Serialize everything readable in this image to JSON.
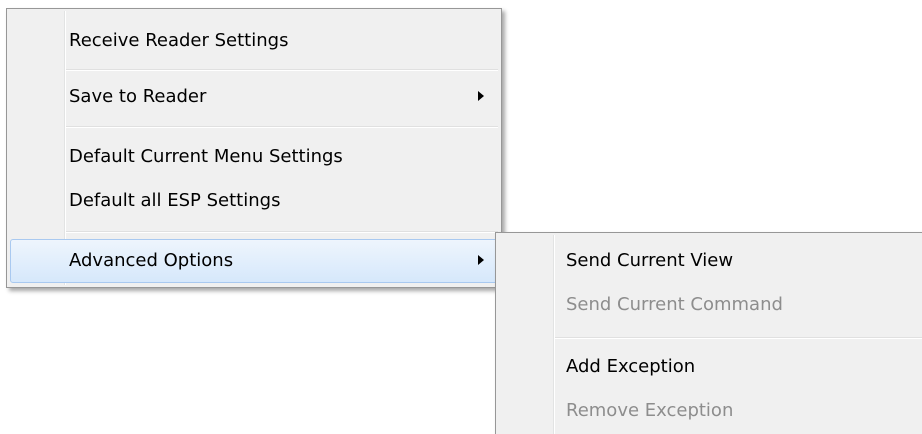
{
  "main_menu": {
    "items": [
      {
        "label": "Receive Reader Settings"
      },
      {
        "label": "Save to Reader"
      },
      {
        "label": "Default Current Menu Settings"
      },
      {
        "label": "Default all ESP Settings"
      },
      {
        "label": "Advanced Options"
      }
    ]
  },
  "submenu": {
    "items": [
      {
        "label": "Send Current View"
      },
      {
        "label": "Send Current Command"
      },
      {
        "label": "Add Exception"
      },
      {
        "label": "Remove Exception"
      }
    ]
  },
  "colors": {
    "menu_background": "#f0f0f0",
    "menu_border": "#979797",
    "highlight_top": "#eef5fd",
    "highlight_bottom": "#d6e8fb",
    "highlight_border": "#a9c9f0",
    "disabled_text": "#8d8d8d"
  },
  "icons": {
    "submenu_arrow": "chevron-right-icon"
  }
}
